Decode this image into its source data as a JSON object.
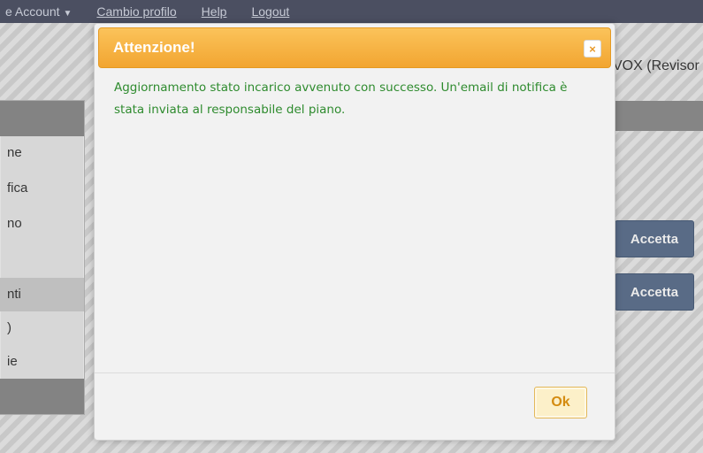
{
  "topnav": {
    "account_label": "e Account",
    "change_profile": "Cambio profilo",
    "help": "Help",
    "logout": "Logout"
  },
  "user_info": "VOX (Revisor",
  "sidebar": {
    "items": [
      {
        "label": "ne"
      },
      {
        "label": "fica"
      },
      {
        "label": "no"
      },
      {
        "label": "nti"
      },
      {
        "label": ")"
      },
      {
        "label": "ie"
      }
    ]
  },
  "actions": {
    "accept_1": "Accetta",
    "accept_2": "Accetta"
  },
  "modal": {
    "title": "Attenzione!",
    "close_symbol": "×",
    "message": "Aggiornamento stato incarico avvenuto con successo. Un'email di notifica è stata inviata al responsabile del piano.",
    "ok_label": "Ok"
  },
  "colors": {
    "modal_header": "#f2a531",
    "message_text": "#2e8b2e",
    "accept_button": "#5b6f8e",
    "topnav": "#4a4f63"
  }
}
